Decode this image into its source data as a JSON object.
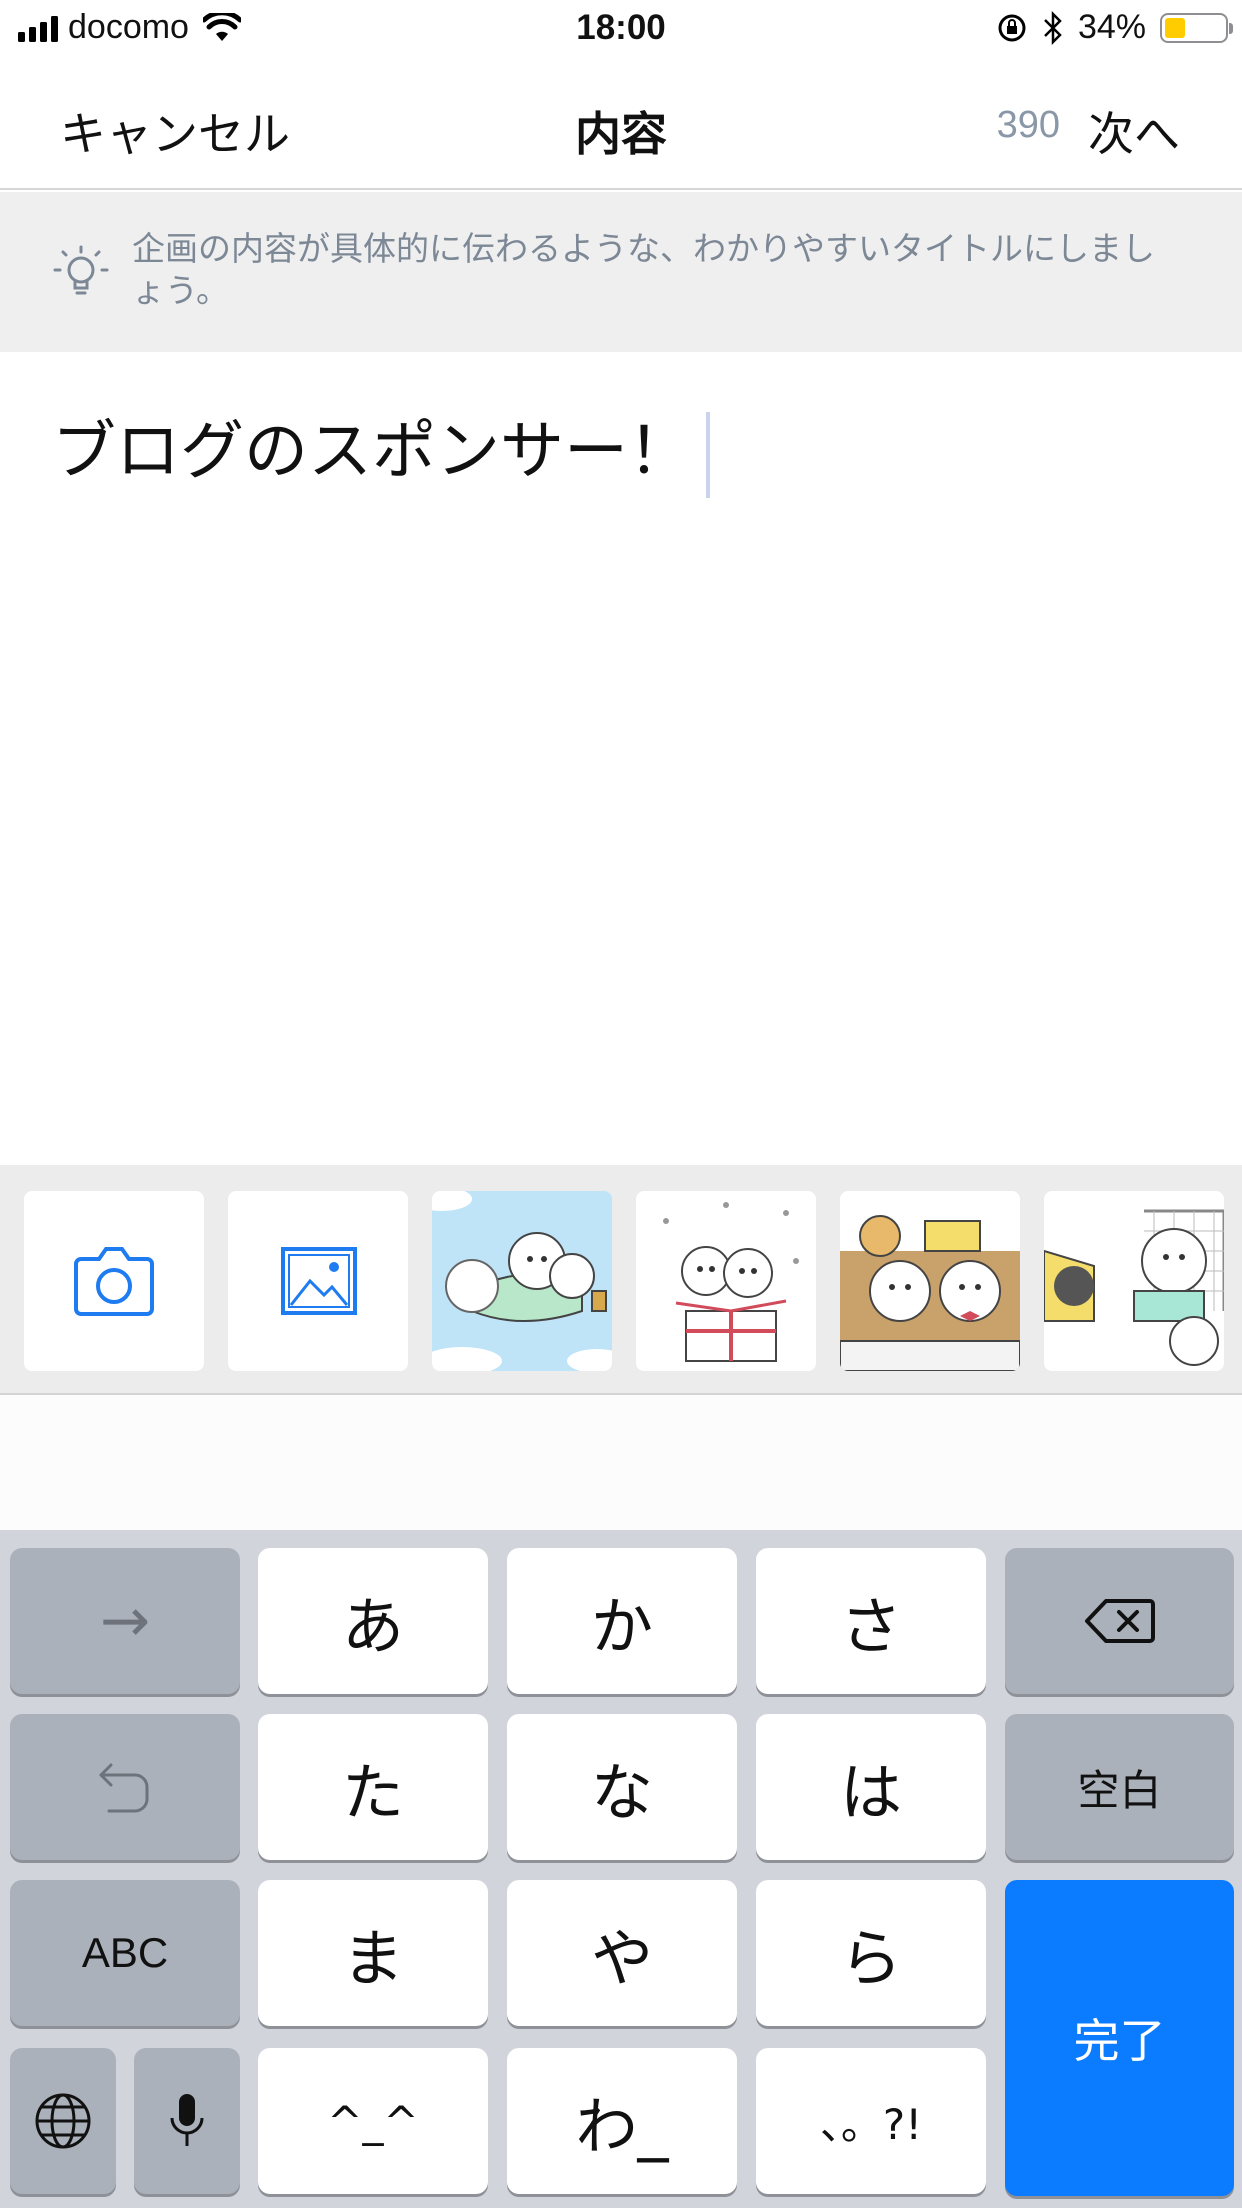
{
  "status_bar": {
    "carrier": "docomo",
    "time": "18:00",
    "battery_percent": "34%",
    "battery_level": 0.34,
    "icons": [
      "signal-icon",
      "wifi-icon",
      "rotation-lock-icon",
      "bluetooth-icon",
      "battery-icon"
    ]
  },
  "nav": {
    "cancel": "キャンセル",
    "title": "内容",
    "count": "390",
    "next": "次へ"
  },
  "hint": {
    "icon": "lightbulb-icon",
    "text": "企画の内容が具体的に伝わるような、わかりやすいタイトルにしましょう。"
  },
  "editor": {
    "value": "ブログのスポンサー！"
  },
  "tray": {
    "items": [
      {
        "kind": "camera-icon"
      },
      {
        "kind": "photo-library-icon"
      },
      {
        "kind": "illustration",
        "accent": "#bfe3f7"
      },
      {
        "kind": "illustration",
        "accent": "#ffffff"
      },
      {
        "kind": "illustration",
        "accent": "#c8a26a"
      },
      {
        "kind": "illustration",
        "accent": "#ffffff"
      }
    ]
  },
  "keyboard": {
    "row1": [
      "→",
      "あ",
      "か",
      "さ",
      "delete-icon"
    ],
    "row2": [
      "undo-icon",
      "た",
      "な",
      "は",
      "空白"
    ],
    "row3": [
      "ABC",
      "ま",
      "や",
      "ら"
    ],
    "row4": [
      "globe-icon",
      "mic-icon",
      "^_^",
      "わ_",
      "、。?!"
    ],
    "done": "完了",
    "colors": {
      "accent": "#0b7bff",
      "key": "#ffffff",
      "function_key": "#abb1ba",
      "background": "#d1d4db"
    }
  }
}
